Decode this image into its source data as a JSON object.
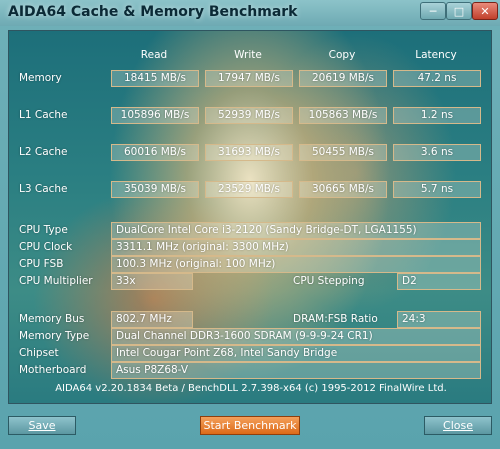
{
  "window": {
    "title": "AIDA64 Cache & Memory Benchmark"
  },
  "columns": {
    "read": "Read",
    "write": "Write",
    "copy": "Copy",
    "latency": "Latency"
  },
  "rows": {
    "memory": {
      "label": "Memory",
      "read": "18415 MB/s",
      "write": "17947 MB/s",
      "copy": "20619 MB/s",
      "latency": "47.2 ns"
    },
    "l1": {
      "label": "L1 Cache",
      "read": "105896 MB/s",
      "write": "52939 MB/s",
      "copy": "105863 MB/s",
      "latency": "1.2 ns"
    },
    "l2": {
      "label": "L2 Cache",
      "read": "60016 MB/s",
      "write": "31693 MB/s",
      "copy": "50455 MB/s",
      "latency": "3.6 ns"
    },
    "l3": {
      "label": "L3 Cache",
      "read": "35039 MB/s",
      "write": "23529 MB/s",
      "copy": "30665 MB/s",
      "latency": "5.7 ns"
    }
  },
  "info": {
    "cpu_type": {
      "label": "CPU Type",
      "value": "DualCore Intel Core i3-2120  (Sandy Bridge-DT, LGA1155)"
    },
    "cpu_clock": {
      "label": "CPU Clock",
      "value": "3311.1 MHz  (original: 3300 MHz)"
    },
    "cpu_fsb": {
      "label": "CPU FSB",
      "value": "100.3 MHz  (original: 100 MHz)"
    },
    "cpu_multiplier": {
      "label": "CPU Multiplier",
      "value": "33x"
    },
    "cpu_stepping": {
      "label": "CPU Stepping",
      "value": "D2"
    },
    "memory_bus": {
      "label": "Memory Bus",
      "value": "802.7 MHz"
    },
    "dram_fsb": {
      "label": "DRAM:FSB Ratio",
      "value": "24:3"
    },
    "memory_type": {
      "label": "Memory Type",
      "value": "Dual Channel DDR3-1600 SDRAM  (9-9-9-24 CR1)"
    },
    "chipset": {
      "label": "Chipset",
      "value": "Intel Cougar Point Z68, Intel Sandy Bridge"
    },
    "motherboard": {
      "label": "Motherboard",
      "value": "Asus P8Z68-V"
    }
  },
  "footer": "AIDA64 v2.20.1834 Beta / BenchDLL 2.7.398-x64  (c) 1995-2012 FinalWire Ltd.",
  "buttons": {
    "save": "Save",
    "start": "Start Benchmark",
    "close": "Close"
  },
  "icons": {
    "minimize": "minimize-icon",
    "maximize": "maximize-icon",
    "close": "close-icon"
  }
}
